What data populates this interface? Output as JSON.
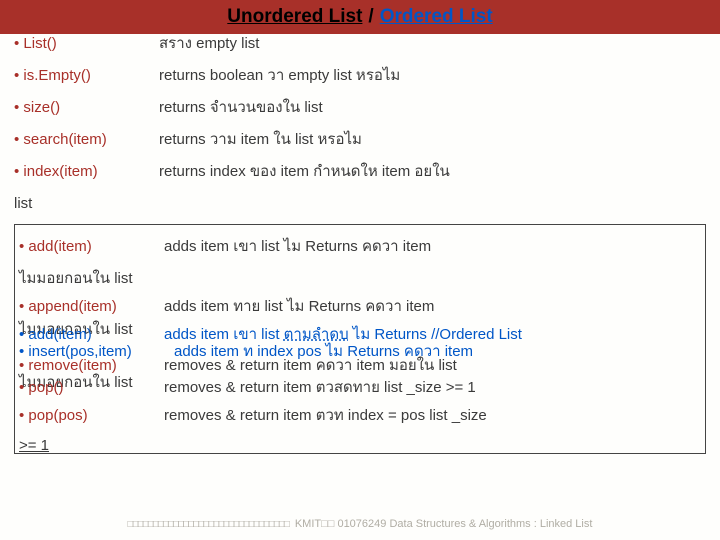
{
  "header": {
    "title_left": "Unordered  List",
    "title_slash": "/",
    "title_right": "Ordered List"
  },
  "top_rows": [
    {
      "method": "• List()",
      "desc": "สราง   empty list"
    },
    {
      "method": "• is.Empty()",
      "desc": "returns boolean  วา    empty list หรอไม"
    },
    {
      "method": "• size()",
      "desc": "returns จำนวนของใน    list"
    },
    {
      "method": "• search(item)",
      "desc": "returns วาม      item ใน list หรอไม"
    },
    {
      "method": "• index(item)",
      "desc": "returns index ของ item                   กำหนดให      item อยใน"
    }
  ],
  "list_word": "list",
  "box": {
    "add": {
      "method": "• add(item)",
      "desc": "adds item เขา    list    ไม    Returns  คดวา       item"
    },
    "line1": "ไมมอยกอนใน             list",
    "append": {
      "method": "• append(item)",
      "desc": "adds item ทาย    list    ไม    Returns            คดวา      item"
    },
    "line2a": "ไมมอยกอนใน             list",
    "add2": {
      "method": "• add(item)",
      "desc2": "adds item เขา   list ",
      "ordered": "ตามลำดบ",
      "desc3": "       ไม   Returns   //Ordered List"
    },
    "insert": {
      "method": "• insert(pos,item)",
      "desc": "adds item ท      index pos  ไม    Returns คดวา      item"
    },
    "remove": {
      "method": "• remove(item)",
      "desc": "removes & return item                       คดวา     item มอยใน         list"
    },
    "line3": "ไมมอยกอนใน             list",
    "pop": {
      "method": "• pop()",
      "desc": "removes & return item ตวสดทาย                        list _size >= 1"
    },
    "poppos": {
      "method": "• pop(pos)",
      "desc": "removes & return item ตวท           index = pos             list _size"
    },
    "last": ">= 1"
  },
  "footer": {
    "glyphs": "□□□□□□□□□□□□□□□□□□□□□□□□□□□□□□□□",
    "mid": "KMIT□□ 01076249 Data Structures & Algorithms : Linked List"
  }
}
